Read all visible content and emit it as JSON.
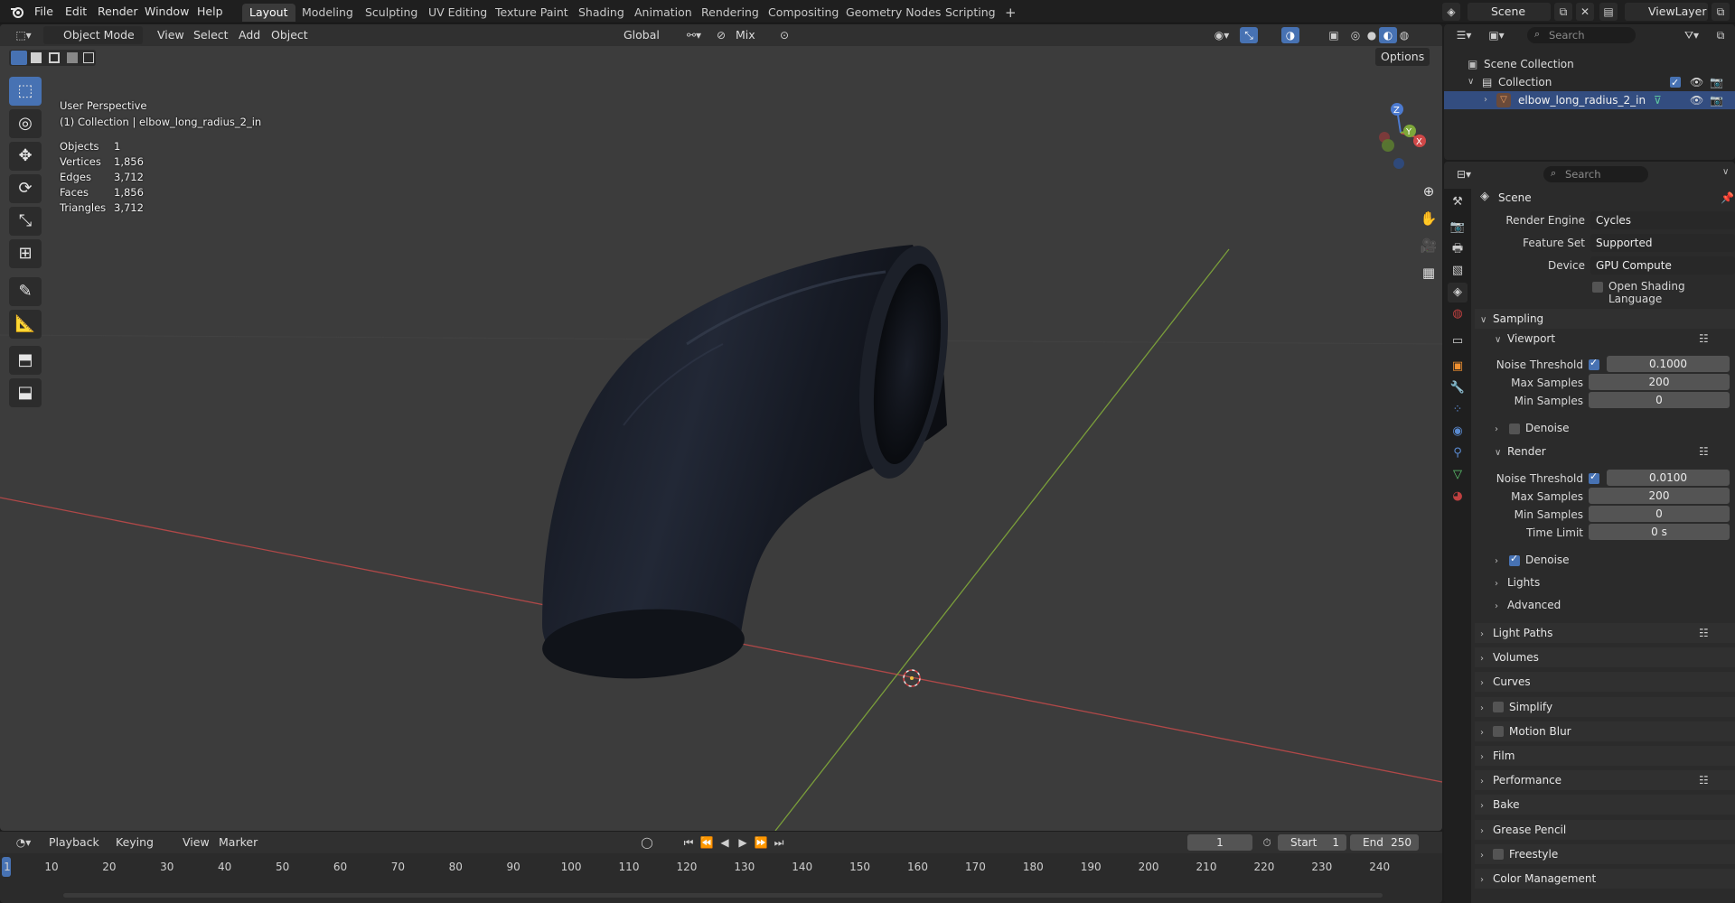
{
  "menu": [
    "File",
    "Edit",
    "Render",
    "Window",
    "Help"
  ],
  "workspaces": [
    "Layout",
    "Modeling",
    "Sculpting",
    "UV Editing",
    "Texture Paint",
    "Shading",
    "Animation",
    "Rendering",
    "Compositing",
    "Geometry Nodes",
    "Scripting"
  ],
  "scene_name": "Scene",
  "view_layer": "ViewLayer",
  "viewport": {
    "mode": "Object Mode",
    "menus": [
      "View",
      "Select",
      "Add",
      "Object"
    ],
    "transform": "Global",
    "snap": "Mix",
    "options": "Options",
    "perspective": "User Perspective",
    "collection_line": "(1) Collection | elbow_long_radius_2_in",
    "stats": [
      {
        "label": "Objects",
        "value": "1"
      },
      {
        "label": "Vertices",
        "value": "1,856"
      },
      {
        "label": "Edges",
        "value": "3,712"
      },
      {
        "label": "Faces",
        "value": "1,856"
      },
      {
        "label": "Triangles",
        "value": "3,712"
      }
    ],
    "gizmo": {
      "x": "X",
      "y": "Y",
      "z": "Z"
    }
  },
  "timeline": {
    "menus": [
      "Playback",
      "Keying",
      "View",
      "Marker"
    ],
    "current_frame": "1",
    "start_label": "Start",
    "start": "1",
    "end_label": "End",
    "end": "250",
    "ticks": [
      "10",
      "20",
      "30",
      "40",
      "50",
      "60",
      "70",
      "80",
      "90",
      "100",
      "110",
      "120",
      "130",
      "140",
      "150",
      "160",
      "170",
      "180",
      "190",
      "200",
      "210",
      "220",
      "230",
      "240"
    ],
    "first_tick": "1"
  },
  "outliner": {
    "search_placeholder": "Search",
    "rows": [
      "Scene Collection",
      "Collection",
      "elbow_long_radius_2_in"
    ]
  },
  "properties": {
    "search_placeholder": "Search",
    "context": "Scene",
    "render_engine_label": "Render Engine",
    "render_engine": "Cycles",
    "feature_set_label": "Feature Set",
    "feature_set": "Supported",
    "device_label": "Device",
    "device": "GPU Compute",
    "osl_label": "Open Shading Language",
    "sampling": "Sampling",
    "viewport_sub": "Viewport",
    "noise_threshold_label": "Noise Threshold",
    "vp_noise_threshold": "0.1000",
    "max_samples_label": "Max Samples",
    "vp_max_samples": "200",
    "min_samples_label": "Min Samples",
    "vp_min_samples": "0",
    "denoise_label": "Denoise",
    "render_sub": "Render",
    "r_noise_threshold": "0.0100",
    "r_max_samples": "200",
    "r_min_samples": "0",
    "time_limit_label": "Time Limit",
    "time_limit": "0 s",
    "lights": "Lights",
    "advanced": "Advanced",
    "panels": [
      "Light Paths",
      "Volumes",
      "Curves",
      "Simplify",
      "Motion Blur",
      "Film",
      "Performance",
      "Bake",
      "Grease Pencil",
      "Freestyle",
      "Color Management"
    ]
  },
  "colors": {
    "accent": "#4772b3",
    "x_axis": "#c44848",
    "y_axis": "#7a9e3a",
    "selection": "#334d80"
  }
}
